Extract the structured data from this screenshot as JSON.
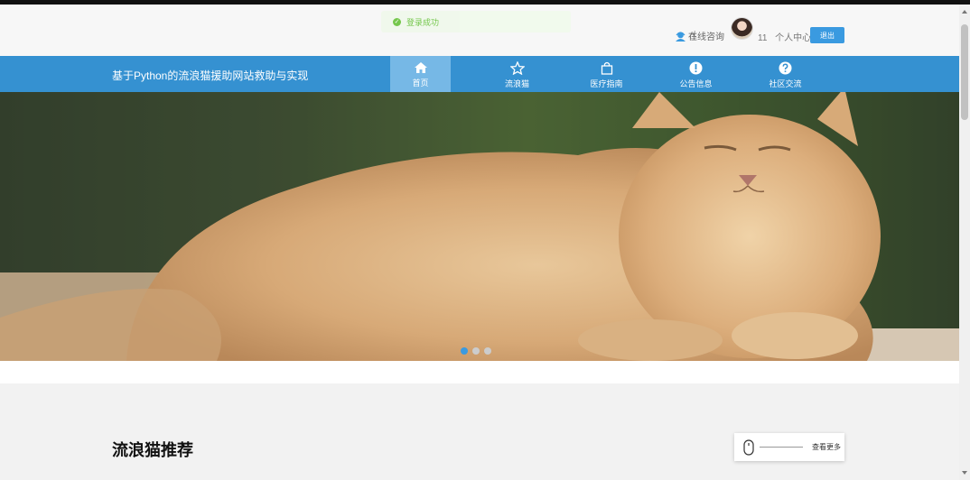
{
  "toast": {
    "message": "登录成功"
  },
  "header": {
    "consult_label": "在线咨询",
    "user_id": "11",
    "personal_center": "个人中心",
    "logout": "退出"
  },
  "nav": {
    "site_title": "基于Python的流浪猫援助网站救助与实现",
    "items": [
      {
        "label": "首页",
        "icon": "home-icon"
      },
      {
        "label": "流浪猫",
        "icon": "star-icon"
      },
      {
        "label": "医疗指南",
        "icon": "bag-icon"
      },
      {
        "label": "公告信息",
        "icon": "exclamation-icon"
      },
      {
        "label": "社区交流",
        "icon": "question-icon"
      }
    ]
  },
  "carousel": {
    "active_index": 0,
    "count": 3
  },
  "section": {
    "title": "流浪猫推荐",
    "more": "查看更多"
  },
  "colors": {
    "primary": "#3591d1",
    "button": "#3a9ae0",
    "success": "#67c23a"
  }
}
